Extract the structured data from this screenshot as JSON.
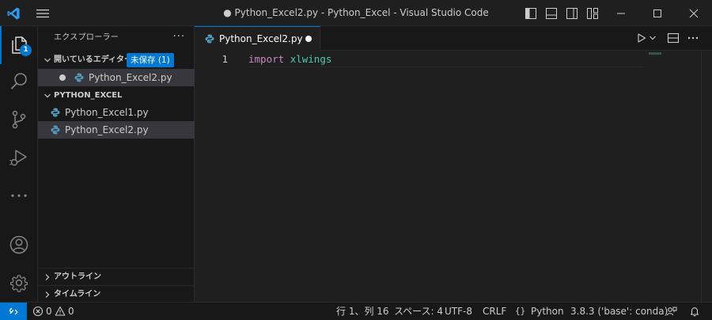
{
  "window": {
    "title": "● Python_Excel2.py - Python_Excel - Visual Studio Code"
  },
  "activity_bar": {
    "explorer_badge": "1"
  },
  "sidebar": {
    "title": "エクスプローラー",
    "more": "···",
    "open_editors": {
      "label": "開いているエディター",
      "unsaved_badge": "未保存 (1)",
      "items": [
        {
          "name": "Python_Excel2.py",
          "modified": true
        }
      ]
    },
    "folder": {
      "label": "PYTHON_EXCEL",
      "items": [
        {
          "name": "Python_Excel1.py"
        },
        {
          "name": "Python_Excel2.py"
        }
      ]
    },
    "outline_label": "アウトライン",
    "timeline_label": "タイムライン"
  },
  "editor": {
    "tab": {
      "name": "Python_Excel2.py"
    },
    "line_number": "1",
    "code": {
      "keyword": "import",
      "module": "xlwings"
    }
  },
  "statusbar": {
    "errors": "0",
    "warnings": "0",
    "position": "行 1、列 16",
    "spaces": "スペース: 4",
    "encoding": "UTF-8",
    "eol": "CRLF",
    "language": "Python",
    "interpreter": "3.8.3 ('base': conda)"
  },
  "colors": {
    "accent": "#0078d4",
    "keyword": "#c586c0",
    "module": "#4ec9b0",
    "python_icon": "#519aba"
  }
}
